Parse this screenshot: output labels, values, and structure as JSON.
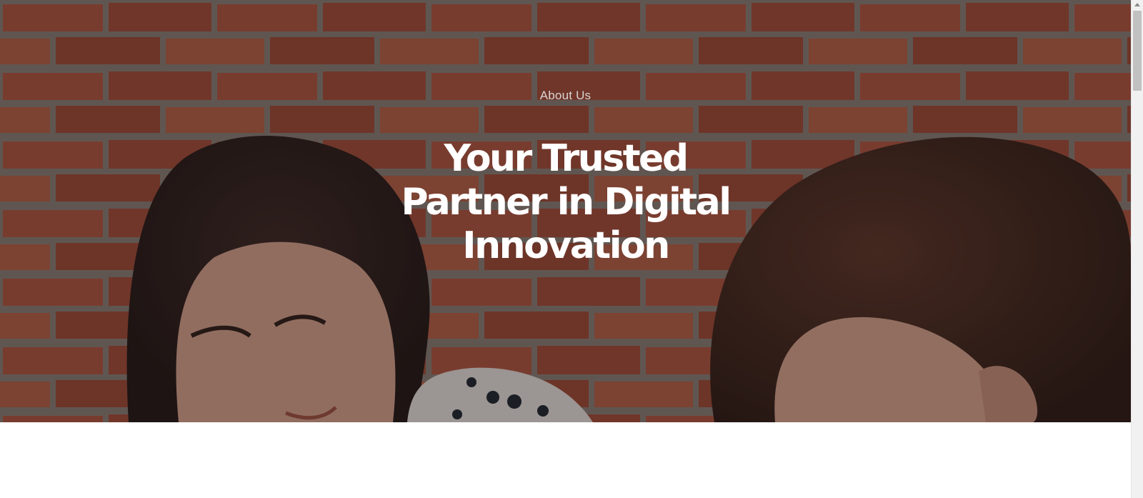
{
  "hero": {
    "eyebrow": "About Us",
    "headline_lines": [
      "Your Trusted",
      "Partner in Digital",
      "Innovation"
    ],
    "background_image": "brick-wall-two-people-photo",
    "overlay_color": "#1e1614"
  },
  "colors": {
    "headline": "#ffffff",
    "eyebrow": "#d9d4d2",
    "page_background": "#ffffff"
  }
}
